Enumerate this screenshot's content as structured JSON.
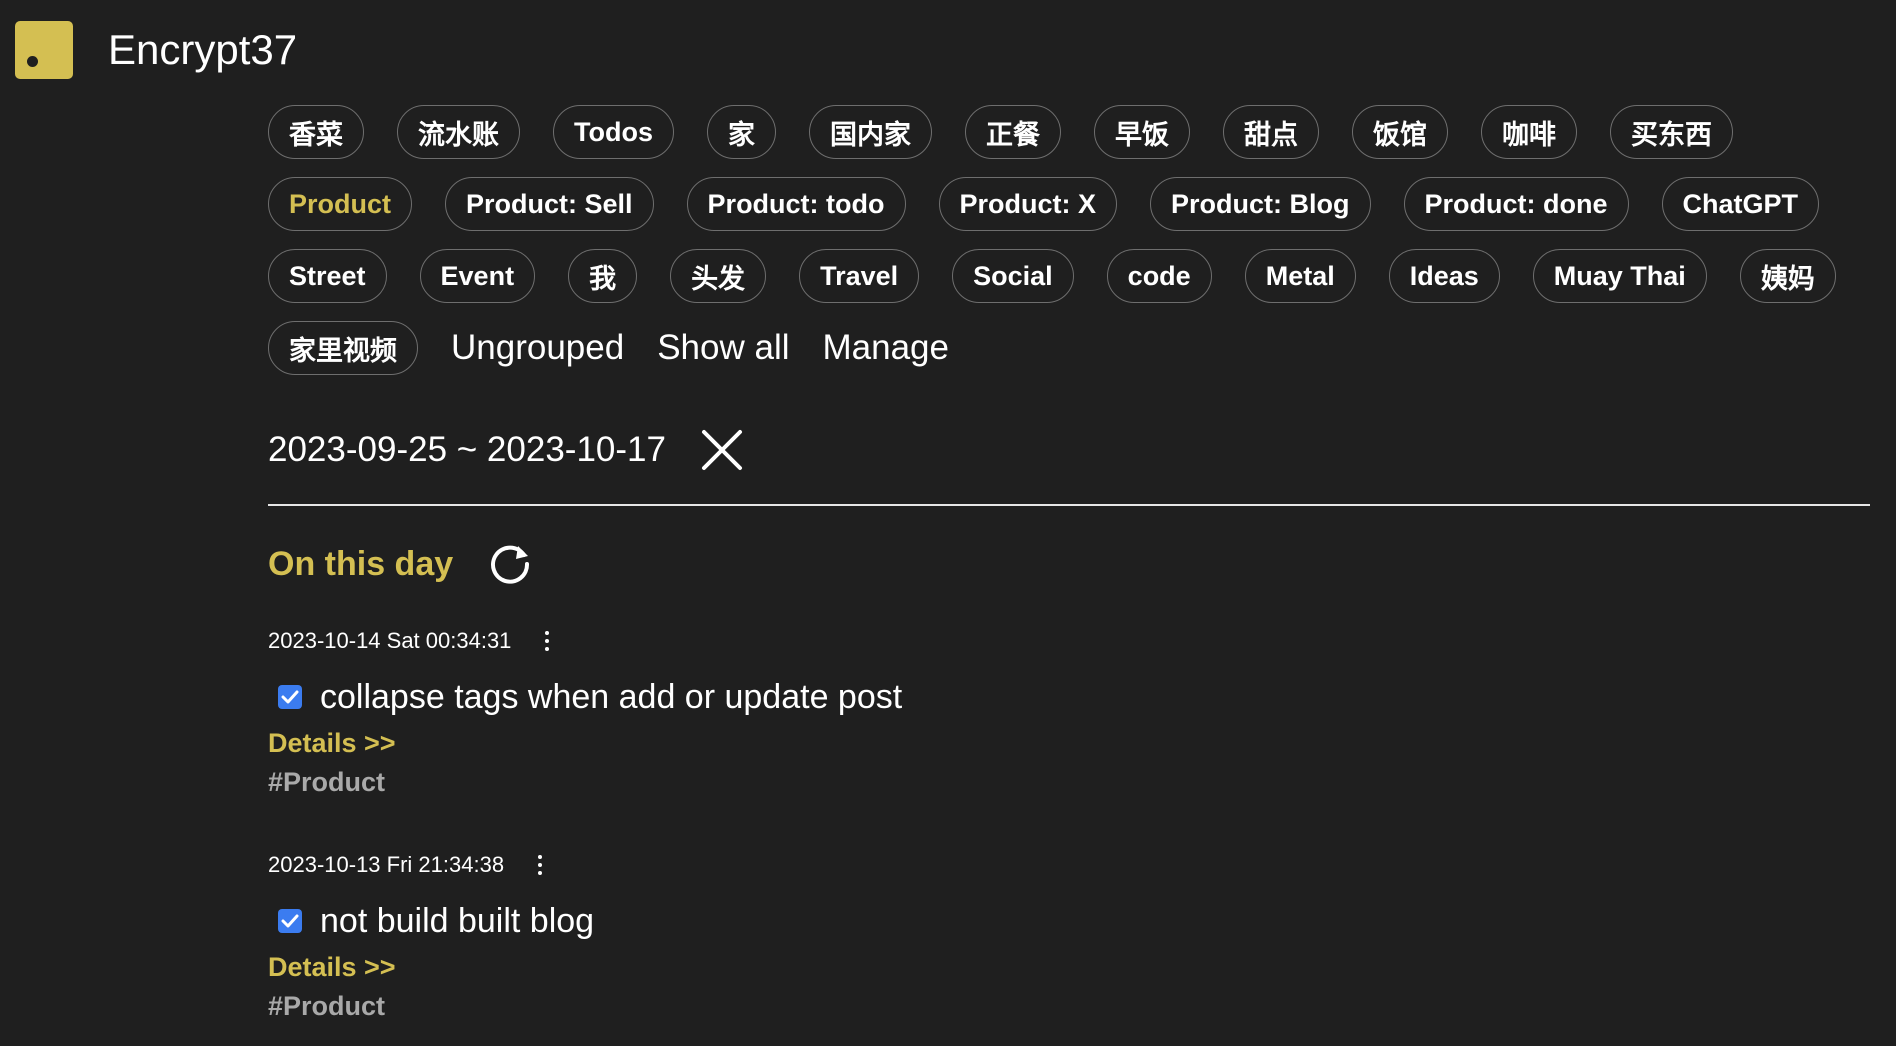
{
  "app": {
    "title": "Encrypt37",
    "logo_color": "#d4bf52"
  },
  "tags": {
    "rows": [
      [
        "香菜",
        "流水账",
        "Todos",
        "家",
        "国内家",
        "正餐",
        "早饭",
        "甜点",
        "饭馆",
        "咖啡",
        "买东西"
      ],
      [
        "Product",
        "Product: Sell",
        "Product: todo",
        "Product: X",
        "Product: Blog",
        "Product: done",
        "ChatGPT"
      ],
      [
        "Street",
        "Event",
        "我",
        "头发",
        "Travel",
        "Social",
        "code",
        "Metal",
        "Ideas",
        "Muay Thai",
        "姨妈"
      ],
      [
        "家里视频"
      ]
    ],
    "active": "Product",
    "links": {
      "ungrouped": "Ungrouped",
      "show_all": "Show all",
      "manage": "Manage"
    }
  },
  "date_filter": {
    "range": "2023-09-25 ~ 2023-10-17"
  },
  "on_this_day": {
    "title": "On this day"
  },
  "posts": [
    {
      "time": "2023-10-14 Sat 00:34:31",
      "checked": true,
      "text": "collapse tags when add or update post",
      "details": "Details >>",
      "tag": "#Product"
    },
    {
      "time": "2023-10-13 Fri 21:34:38",
      "checked": true,
      "text": "not build built blog",
      "details": "Details >>",
      "tag": "#Product"
    }
  ],
  "colors": {
    "background": "#1f1f1f",
    "accent": "#d4bf52",
    "checkbox": "#3b7cf0",
    "tag_text_muted": "#a9a9a9"
  }
}
